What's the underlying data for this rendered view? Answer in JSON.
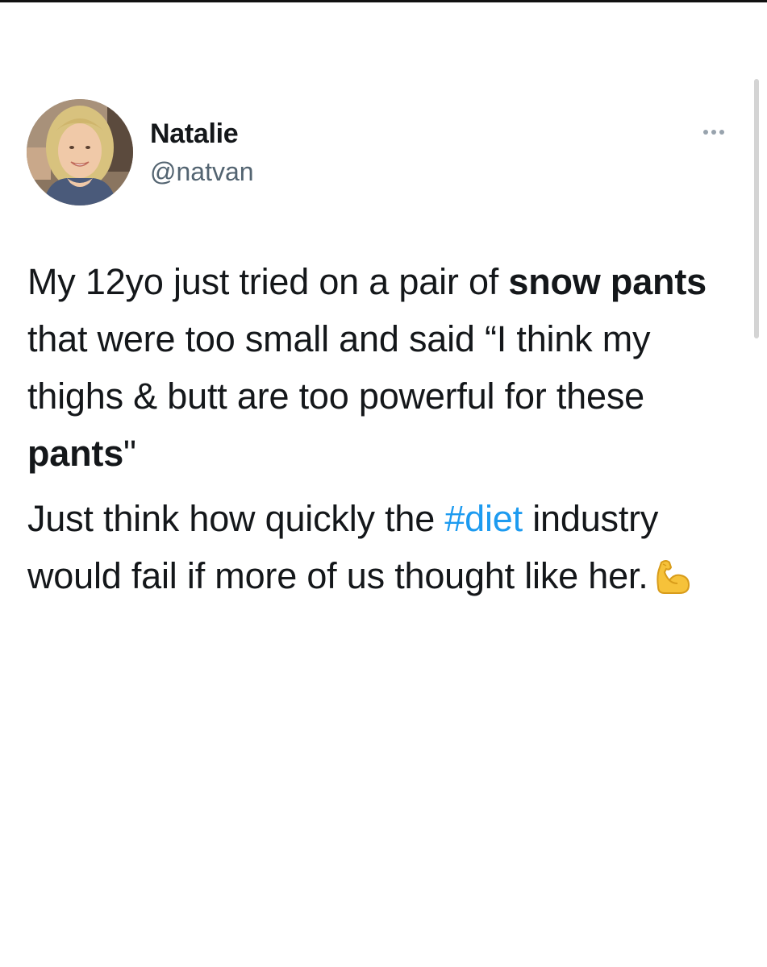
{
  "tweet": {
    "author": {
      "display_name": "Natalie",
      "handle": "@natvan"
    },
    "more_label": "More options",
    "paragraph_1": {
      "seg_1": "My 12yo just tried on a pair of ",
      "seg_2_bold": "snow pants",
      "seg_3": " that were too small and said “I think my thighs & butt are too powerful for these ",
      "seg_4_bold": "pants",
      "seg_5": "\""
    },
    "paragraph_2": {
      "seg_1": "Just think how quickly the ",
      "hashtag": "#diet",
      "seg_2": " industry would fail if more of us thought like her.",
      "emoji": "flexed-biceps"
    }
  },
  "colors": {
    "text": "#14171a",
    "secondary_text": "#536471",
    "link": "#1d9bf0",
    "background": "#ffffff"
  }
}
